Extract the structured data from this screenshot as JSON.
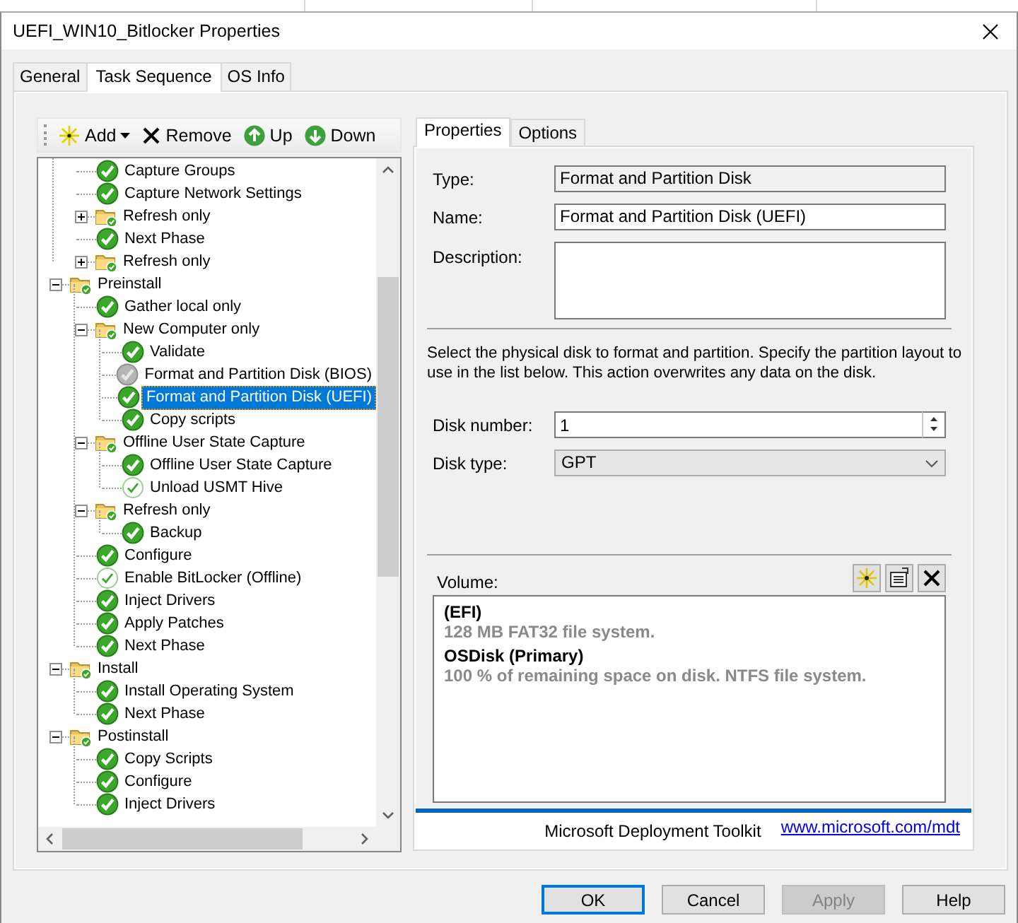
{
  "window": {
    "title": "UEFI_WIN10_Bitlocker Properties"
  },
  "tabs": [
    {
      "label": "General",
      "selected": false
    },
    {
      "label": "Task Sequence",
      "selected": true
    },
    {
      "label": "OS Info",
      "selected": false
    }
  ],
  "toolbar": [
    {
      "kind": "add",
      "label": "Add",
      "dropdown": true
    },
    {
      "kind": "remove",
      "label": "Remove",
      "dropdown": false
    },
    {
      "kind": "up",
      "label": "Up",
      "dropdown": false
    },
    {
      "kind": "down",
      "label": "Down",
      "dropdown": false
    }
  ],
  "tree": {
    "partial_items": [
      {
        "kind": "step",
        "label": "Capture Groups",
        "disabled": false,
        "continue_on_error": false,
        "selected": false
      },
      {
        "kind": "step",
        "label": "Capture Network Settings",
        "disabled": false,
        "continue_on_error": false,
        "selected": false
      },
      {
        "kind": "group",
        "label": "Refresh only",
        "expanded": false,
        "selected": false
      },
      {
        "kind": "step",
        "label": "Next Phase",
        "disabled": false,
        "continue_on_error": false,
        "selected": false
      },
      {
        "kind": "group",
        "label": "Refresh only",
        "expanded": false,
        "selected": false
      }
    ],
    "items": [
      {
        "kind": "group",
        "label": "Preinstall",
        "expanded": true,
        "selected": false,
        "children": [
          {
            "kind": "step",
            "label": "Gather local only",
            "disabled": false,
            "continue_on_error": false,
            "selected": false
          },
          {
            "kind": "group",
            "label": "New Computer only",
            "expanded": true,
            "selected": false,
            "children": [
              {
                "kind": "step",
                "label": "Validate",
                "disabled": false,
                "continue_on_error": false,
                "selected": false
              },
              {
                "kind": "step",
                "label": "Format and Partition Disk (BIOS)",
                "disabled": true,
                "continue_on_error": false,
                "selected": false
              },
              {
                "kind": "step",
                "label": "Format and Partition Disk (UEFI)",
                "disabled": false,
                "continue_on_error": false,
                "selected": true
              },
              {
                "kind": "step",
                "label": "Copy scripts",
                "disabled": false,
                "continue_on_error": false,
                "selected": false
              }
            ]
          },
          {
            "kind": "group",
            "label": "Offline User State Capture",
            "expanded": true,
            "selected": false,
            "children": [
              {
                "kind": "step",
                "label": "Offline User State Capture",
                "disabled": false,
                "continue_on_error": false,
                "selected": false
              },
              {
                "kind": "step",
                "label": "Unload USMT Hive",
                "disabled": false,
                "continue_on_error": true,
                "selected": false
              }
            ]
          },
          {
            "kind": "group",
            "label": "Refresh only",
            "expanded": true,
            "selected": false,
            "children": [
              {
                "kind": "step",
                "label": "Backup",
                "disabled": false,
                "continue_on_error": false,
                "selected": false
              }
            ]
          },
          {
            "kind": "step",
            "label": "Configure",
            "disabled": false,
            "continue_on_error": false,
            "selected": false
          },
          {
            "kind": "step",
            "label": "Enable BitLocker (Offline)",
            "disabled": false,
            "continue_on_error": true,
            "selected": false
          },
          {
            "kind": "step",
            "label": "Inject Drivers",
            "disabled": false,
            "continue_on_error": false,
            "selected": false
          },
          {
            "kind": "step",
            "label": "Apply Patches",
            "disabled": false,
            "continue_on_error": false,
            "selected": false
          },
          {
            "kind": "step",
            "label": "Next Phase",
            "disabled": false,
            "continue_on_error": false,
            "selected": false
          }
        ]
      },
      {
        "kind": "group",
        "label": "Install",
        "expanded": true,
        "selected": false,
        "children": [
          {
            "kind": "step",
            "label": "Install Operating System",
            "disabled": false,
            "continue_on_error": false,
            "selected": false
          },
          {
            "kind": "step",
            "label": "Next Phase",
            "disabled": false,
            "continue_on_error": false,
            "selected": false
          }
        ]
      },
      {
        "kind": "group",
        "label": "Postinstall",
        "expanded": true,
        "selected": false,
        "children": [
          {
            "kind": "step",
            "label": "Copy Scripts",
            "disabled": false,
            "continue_on_error": false,
            "selected": false
          },
          {
            "kind": "step",
            "label": "Configure",
            "disabled": false,
            "continue_on_error": false,
            "selected": false
          },
          {
            "kind": "step",
            "label": "Inject Drivers",
            "disabled": false,
            "continue_on_error": false,
            "selected": false
          }
        ]
      }
    ]
  },
  "properties": {
    "tabs": [
      {
        "label": "Properties",
        "selected": true
      },
      {
        "label": "Options",
        "selected": false
      }
    ],
    "type": {
      "label": "Type:",
      "value": "Format and Partition Disk"
    },
    "name": {
      "label": "Name:",
      "value": "Format and Partition Disk (UEFI)"
    },
    "description": {
      "label": "Description:"
    },
    "instructions": "Select the physical disk to format and partition.  Specify the partition layout to use in the list below. This action overwrites any data on the disk.",
    "disk_number": {
      "label": "Disk number:",
      "value": "1"
    },
    "disk_type": {
      "label": "Disk type:",
      "value": "GPT"
    },
    "volume": {
      "label": "Volume:",
      "entries": [
        {
          "name": " (EFI)",
          "detail": "128 MB FAT32 file system."
        },
        {
          "name": "OSDisk (Primary)",
          "detail": "100 % of remaining space on disk. NTFS file system."
        }
      ]
    }
  },
  "footer": {
    "product": "Microsoft Deployment Toolkit",
    "link": "www.microsoft.com/mdt"
  },
  "buttons": [
    {
      "label": "OK",
      "default": true,
      "disabled": false
    },
    {
      "label": "Cancel",
      "default": false,
      "disabled": false
    },
    {
      "label": "Apply",
      "default": false,
      "disabled": true
    },
    {
      "label": "Help",
      "default": false,
      "disabled": false
    }
  ]
}
